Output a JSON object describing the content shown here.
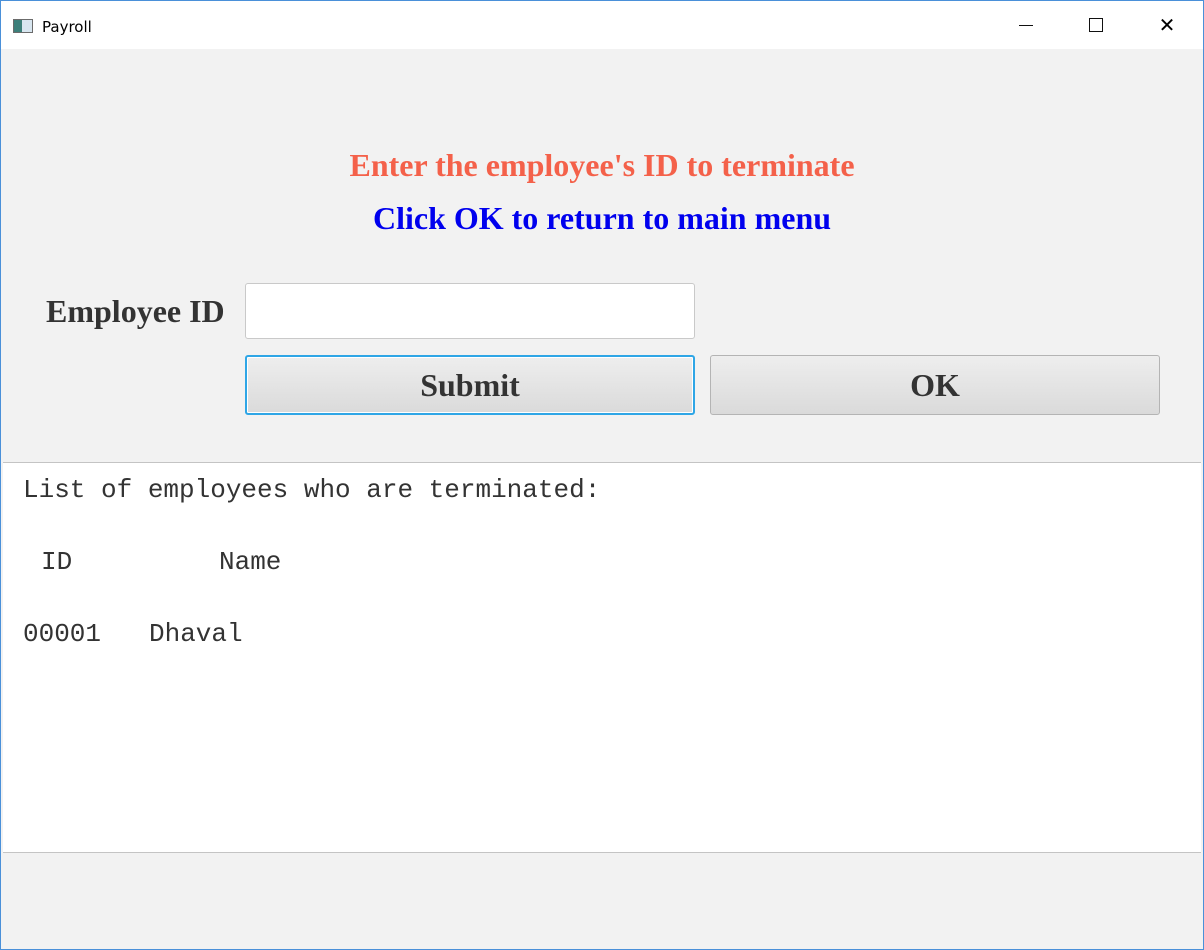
{
  "window": {
    "title": "Payroll"
  },
  "form": {
    "instruction": "Enter the employee's ID to terminate",
    "return_hint": "Click OK to return to main menu",
    "employee_id_label": "Employee ID",
    "employee_id_value": "",
    "submit_label": "Submit",
    "ok_label": "OK"
  },
  "output": {
    "title": "List of employees who are terminated:",
    "columns": [
      "ID",
      "Name"
    ],
    "rows": [
      {
        "id": "00001",
        "name": "Dhaval"
      }
    ]
  },
  "colors": {
    "instruction": "#f4614a",
    "return_hint": "#0000ee",
    "focus_border": "#2fa6e6"
  },
  "icons": {
    "app": "payroll-app-icon",
    "minimize": "minimize-icon",
    "maximize": "maximize-icon",
    "close": "close-icon"
  }
}
